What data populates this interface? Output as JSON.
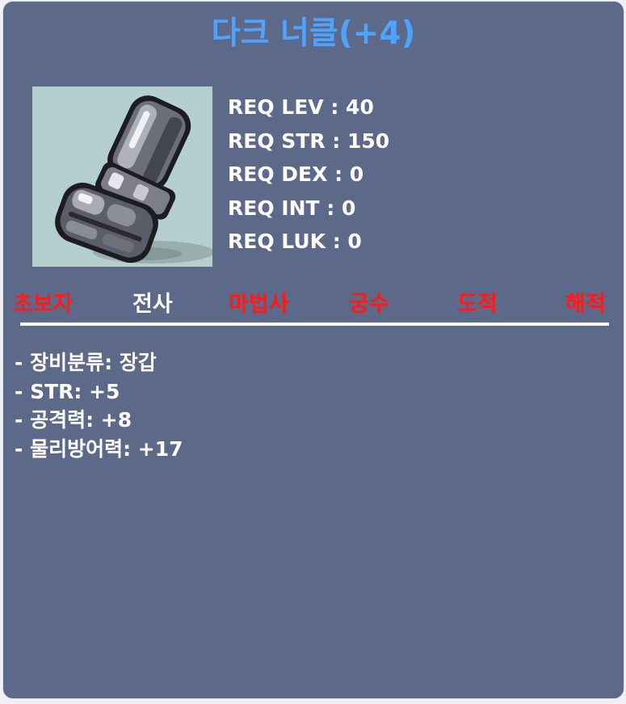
{
  "item": {
    "title": "다크 너클(+4)",
    "title_color": "#4fa3ff",
    "icon": "dark-knuckle-glove-icon"
  },
  "requirements": [
    "REQ LEV : 40",
    "REQ STR : 150",
    "REQ DEX : 0",
    "REQ INT : 0",
    "REQ LUK : 0"
  ],
  "jobs": [
    {
      "label": "초보자",
      "color": "#ff1a1a"
    },
    {
      "label": "전사",
      "color": "#ffffff"
    },
    {
      "label": "마법사",
      "color": "#ff1a1a"
    },
    {
      "label": "궁수",
      "color": "#ff1a1a"
    },
    {
      "label": "도적",
      "color": "#ff1a1a"
    },
    {
      "label": "해적",
      "color": "#ff1a1a"
    }
  ],
  "stats": [
    "- 장비분류: 장갑",
    "- STR: +5",
    "- 공격력: +8",
    "- 물리방어력: +17"
  ],
  "colors": {
    "card_background": "#5d6988",
    "unavailable_job": "#ff1a1a",
    "available_job": "#ffffff"
  }
}
